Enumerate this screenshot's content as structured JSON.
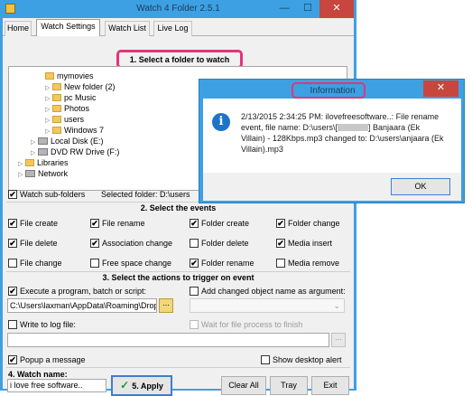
{
  "app": {
    "title": "Watch 4 Folder 2.5.1",
    "min": "—",
    "max": "☐",
    "close": "✕"
  },
  "tabs": [
    "Home",
    "Watch Settings",
    "Watch List",
    "Live Log"
  ],
  "section1": {
    "title": "1. Select a folder to watch"
  },
  "tree": [
    {
      "label": "mymovies",
      "type": "folder"
    },
    {
      "label": "New folder (2)",
      "type": "folder"
    },
    {
      "label": "pc Music",
      "type": "folder"
    },
    {
      "label": "Photos",
      "type": "folder"
    },
    {
      "label": "users",
      "type": "folder"
    },
    {
      "label": "Windows 7",
      "type": "folder"
    },
    {
      "label": "Local Disk (E:)",
      "type": "drive"
    },
    {
      "label": "DVD RW Drive (F:)",
      "type": "drive"
    },
    {
      "label": "Libraries",
      "type": "folder"
    },
    {
      "label": "Network",
      "type": "drive"
    }
  ],
  "watch_subfolders": {
    "label": "Watch sub-folders",
    "checked": true
  },
  "selected_folder": "Selected folder: D:\\users",
  "section2": {
    "title": "2. Select the events"
  },
  "events": [
    {
      "label": "File create",
      "checked": true
    },
    {
      "label": "File rename",
      "checked": true
    },
    {
      "label": "Folder create",
      "checked": true
    },
    {
      "label": "Folder change",
      "checked": true
    },
    {
      "label": "File delete",
      "checked": true
    },
    {
      "label": "Association change",
      "checked": true
    },
    {
      "label": "Folder delete",
      "checked": false
    },
    {
      "label": "Media insert",
      "checked": true
    },
    {
      "label": "File change",
      "checked": false
    },
    {
      "label": "Free space change",
      "checked": false
    },
    {
      "label": "Folder rename",
      "checked": true
    },
    {
      "label": "Media remove",
      "checked": false
    }
  ],
  "section3": {
    "title": "3. Select the actions to trigger on event"
  },
  "actions": {
    "execute": {
      "label": "Execute a program, batch or script:",
      "checked": true
    },
    "add_name": {
      "label": "Add changed object name as argument:",
      "checked": false
    },
    "program_path": "C:\\Users\\laxman\\AppData\\Roaming\\Dropbo",
    "write_log": {
      "label": "Write to log file:",
      "checked": false
    },
    "wait_finish": {
      "label": "Wait for file process to finish",
      "checked": false
    },
    "log_path": "",
    "popup": {
      "label": "Popup a message",
      "checked": true
    },
    "desktop_alert": {
      "label": "Show desktop alert",
      "checked": false
    }
  },
  "section4": {
    "title": "4. Watch name:",
    "value": "i love free software.."
  },
  "buttons": {
    "apply": "5. Apply",
    "clear_all": "Clear All",
    "tray": "Tray",
    "exit": "Exit"
  },
  "dialog": {
    "title": "Information",
    "close": "✕",
    "message_line1": "2/13/2015 2:34:25 PM: ilovefreesoftware..: File rename",
    "message_line2a": "event, file name: D:\\users\\[",
    "message_line2b": "] Banjaara (Ek",
    "message_line3": "Villain) - 128Kbps.mp3 changed to: D:\\users\\anjaara (Ek",
    "message_line4": "Villain).mp3",
    "ok": "OK"
  },
  "colors": {
    "title_bar": "#3da0e3",
    "highlight": "#e3347b",
    "close": "#c7463e"
  }
}
